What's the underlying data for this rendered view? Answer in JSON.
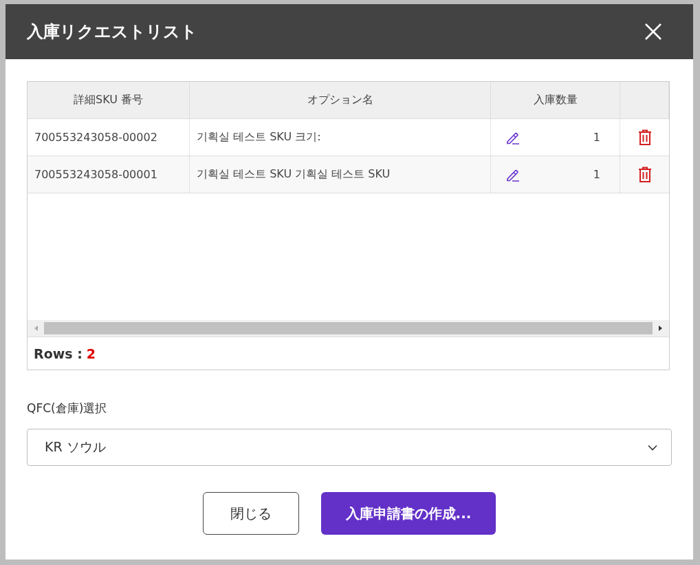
{
  "dialog": {
    "title": "入庫リクエストリスト"
  },
  "table": {
    "columns": [
      "詳細SKU 番号",
      "オプション名",
      "入庫数量"
    ],
    "rows": [
      {
        "sku": "700553243058-00002",
        "option": "기획실 테스트 SKU 크기:",
        "quantity": "1"
      },
      {
        "sku": "700553243058-00001",
        "option": "기획실 테스트 SKU 기획실 테스트 SKU",
        "quantity": "1"
      }
    ],
    "rows_label": "Rows :",
    "rows_count": "2"
  },
  "warehouse": {
    "label": "QFC(倉庫)選択",
    "value": "KR ソウル"
  },
  "buttons": [
    {
      "label": "閉じる",
      "kind": "secondary"
    },
    {
      "label": "入庫申請書の作成...",
      "kind": "primary"
    }
  ]
}
